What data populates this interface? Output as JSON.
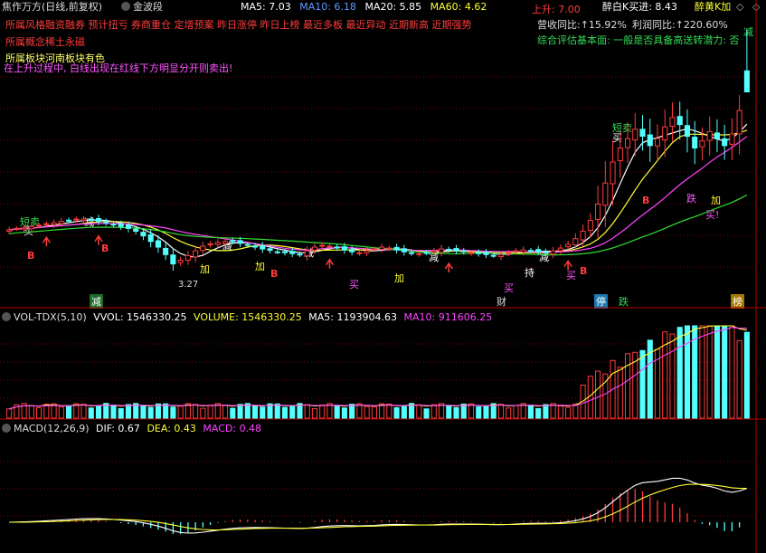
{
  "header": {
    "stock_title": "焦作万方",
    "period": "(日线,前复权)",
    "indicator_selector": "金波段",
    "ma_labels": [
      "MA5: 7.03",
      "MA10: 6.18",
      "MA20: 5.85",
      "MA60: 4.62"
    ],
    "ma_colors": [
      "#ffffff",
      "#5b9bff",
      "#ffffff",
      "#ffff33"
    ],
    "right_label": "醉白K买进: 8.43",
    "right_label2": "醉黄K加",
    "nav_prev": "◇",
    "nav_next": "◇"
  },
  "info_lines": {
    "line1": "所属风格融资融券 预计扭亏 券商重仓 定增预案 昨日涨停 昨日上榜 最近多板 最近异动 近期新高 近期强势",
    "line2": "所属概念稀土永磁",
    "line3": "所属板块河南板块有色",
    "line4": "在上升过程中, 白线出现在红线下方明显分开则卖出!"
  },
  "fundamentals": {
    "upward": "上升: 7.00",
    "revenue_yoy": "营收同比:↑15.92%",
    "profit_yoy": "利润同比:↑220.60%",
    "summary": "综合评估基本面: 一般是否具备高送转潜力: 否",
    "reduce_tag": "减"
  },
  "signals": {
    "short_sell_1": "短卖",
    "buy_1": "买",
    "short_sell_2": "短卖",
    "buy_2": "买",
    "reduce": "减",
    "add": "加",
    "buy": "买",
    "buy_ex": "买!",
    "dip": "跌",
    "b": "B",
    "low_price": "3.27",
    "hold": "持",
    "finance": "财",
    "limit_up": "停",
    "fall": "跌",
    "list": "榜"
  },
  "volume_header": {
    "name": "VOL-TDX(5,10)",
    "vvol": "VVOL: 1546330.25",
    "volume": "VOLUME: 1546330.25",
    "ma5": "MA5: 1193904.63",
    "ma10": "MA10: 911606.25"
  },
  "macd_header": {
    "name": "MACD(12,26,9)",
    "dif": "DIF: 0.67",
    "dea": "DEA: 0.43",
    "macd": "MACD: 0.48"
  },
  "colors": {
    "up": "#ff3b3b",
    "down": "#54ffff",
    "ma5": "#ffffff",
    "ma10": "#ffff33",
    "ma20": "#ff44ff",
    "ma60": "#33dd33",
    "grid": "#7a0000"
  },
  "chart_data": {
    "type": "candlestick",
    "title": "焦作万方 (日线,前复权)",
    "price_range": [
      2.6,
      8.6
    ],
    "bars": 100,
    "close": [
      4.15,
      4.18,
      4.2,
      4.22,
      4.25,
      4.28,
      4.3,
      4.33,
      4.35,
      4.38,
      4.38,
      4.36,
      4.33,
      4.3,
      4.26,
      4.22,
      4.18,
      4.12,
      4.02,
      3.9,
      3.78,
      3.62,
      3.42,
      3.5,
      3.6,
      3.7,
      3.8,
      3.85,
      3.88,
      3.9,
      3.9,
      3.86,
      3.82,
      3.78,
      3.74,
      3.71,
      3.68,
      3.66,
      3.64,
      3.62,
      3.7,
      3.78,
      3.82,
      3.8,
      3.76,
      3.72,
      3.68,
      3.66,
      3.7,
      3.74,
      3.78,
      3.76,
      3.72,
      3.68,
      3.65,
      3.64,
      3.66,
      3.7,
      3.74,
      3.72,
      3.7,
      3.68,
      3.66,
      3.64,
      3.62,
      3.6,
      3.62,
      3.66,
      3.7,
      3.72,
      3.7,
      3.68,
      3.66,
      3.7,
      3.76,
      3.84,
      3.96,
      4.12,
      4.35,
      4.7,
      5.15,
      5.6,
      5.9,
      6.1,
      6.3,
      6.15,
      5.95,
      6.1,
      6.35,
      6.55,
      6.4,
      6.15,
      5.9,
      6.05,
      6.25,
      6.1,
      5.95,
      6.2,
      6.6,
      7.1
    ],
    "volume_header_values": {
      "vvol": 1546330.25,
      "volume": 1546330.25,
      "ma5": 1193904.63,
      "ma10": 911606.25
    },
    "macd_values": {
      "dif": 0.67,
      "dea": 0.43,
      "macd": 0.48
    },
    "ma_values": {
      "ma5": 7.03,
      "ma10": 6.18,
      "ma20": 5.85,
      "ma60": 4.62
    }
  }
}
